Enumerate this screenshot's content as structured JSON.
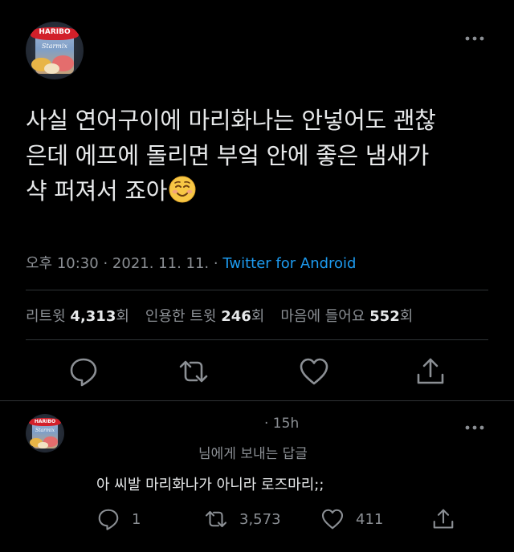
{
  "tweet": {
    "text_lines": [
      "사실 연어구이에 마리화나는 안넣어도 괜찮",
      "은데 에프에 돌리면 부엌 안에 좋은 냄새가",
      "샥 퍼져서 죠아"
    ],
    "emoji": "smiling-face-icon",
    "time": "오후 10:30",
    "separator": "·",
    "date": "2021. 11. 11.",
    "source": "Twitter for Android",
    "stats": {
      "retweets_label": "리트윗",
      "retweets_value": "4,313",
      "retweets_unit": "회",
      "quotes_label": "인용한 트윗",
      "quotes_value": "246",
      "quotes_unit": "회",
      "likes_label": "마음에 들어요",
      "likes_value": "552",
      "likes_unit": "회"
    },
    "avatar_brand": "HARIBO",
    "avatar_sub": "Starmix"
  },
  "reply": {
    "time": "· 15h",
    "replying_to": "님에게 보내는 답글",
    "text": "아 씨발 마리화나가 아니라 로즈마리;;",
    "reply_count": "1",
    "retweet_count": "3,573",
    "like_count": "411",
    "avatar_brand": "HARIBO",
    "avatar_sub": "Starmix"
  },
  "colors": {
    "background": "#000000",
    "link": "#1d9bf0",
    "muted": "#8b8f94",
    "text": "#e7e9ea",
    "divider": "#2f3336"
  }
}
